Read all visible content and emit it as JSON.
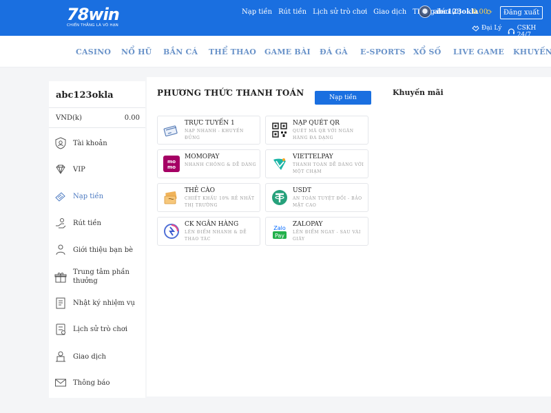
{
  "header": {
    "logo_text": "78win",
    "logo_slogan": "CHIẾN THẮNG LÀ VÔ HẠN",
    "links": [
      "Nạp tiền",
      "Rút tiền",
      "Lịch sử trò chơi",
      "Giao dịch",
      "Thông báo (0)"
    ],
    "username": "abc123okla",
    "balance": "0.00",
    "logout_label": "Đăng xuất",
    "agent_label": "Đại Lý",
    "support_label": "CSKH 24/7"
  },
  "nav": {
    "items": [
      "CASINO",
      "NỔ HŨ",
      "BẮN CÁ",
      "THỂ THAO",
      "GAME BÀI",
      "ĐÁ GÀ",
      "E-SPORTS",
      "XỔ SỐ",
      "LIVE GAME",
      "KHUYẾN MÃI"
    ]
  },
  "sidebar": {
    "username": "abc123okla",
    "balance_label": "VND(k)",
    "balance_value": "0.00",
    "items": [
      {
        "label": "Tài khoản",
        "icon": "user-shield-icon"
      },
      {
        "label": "VIP",
        "icon": "vip-diamond-icon"
      },
      {
        "label": "Nạp tiền",
        "icon": "deposit-icon"
      },
      {
        "label": "Rút tiền",
        "icon": "withdraw-icon"
      },
      {
        "label": "Giới thiệu bạn bè",
        "icon": "refer-friend-icon"
      },
      {
        "label": "Trung tâm phần",
        "label2": "thưởng",
        "icon": "gift-icon"
      },
      {
        "label": "Nhật ký nhiệm vụ",
        "icon": "task-log-icon"
      },
      {
        "label": "Lịch sử trò chơi",
        "icon": "game-history-icon"
      },
      {
        "label": "Giao dịch",
        "icon": "transaction-icon"
      },
      {
        "label": "Thông báo",
        "icon": "mail-icon"
      }
    ],
    "active_index": 2
  },
  "main": {
    "payment_title": "PHƯƠNG THỨC THANH TOÁN",
    "deposit_button": "Nạp tiền",
    "promo_title": "Khuyến mãi",
    "methods": [
      {
        "name": "TRỰC TUYẾN 1",
        "desc": "NẠP NHANH - KHUYẾN ĐỦNG",
        "icon": "online-card-icon"
      },
      {
        "name": "NẠP QUÉT QR",
        "desc": "QUÉT MÃ QR VỚI NGÂN HÀNG ĐA DẠNG",
        "icon": "qr-code-icon"
      },
      {
        "name": "MOMOPAY",
        "desc": "NHANH CHÓNG & DỄ DÀNG",
        "icon": "momo-icon"
      },
      {
        "name": "VIETTELPAY",
        "desc": "THANH TOÁN DỄ DÀNG VỚI MỘT CHẠM",
        "icon": "viettelpay-icon"
      },
      {
        "name": "THẺ CÀO",
        "desc": "CHIẾT KHẤU 10% RẺ NHẤT THỊ TRƯỜNG",
        "icon": "scratch-card-icon"
      },
      {
        "name": "USDT",
        "desc": "AN TOÀN TUYỆT ĐỐI - BẢO MẬT CAO",
        "icon": "usdt-icon"
      },
      {
        "name": "CK NGÂN HÀNG",
        "desc": "LÊN ĐIỂM NHANH & DỄ THAO TÁC",
        "icon": "bank-transfer-icon"
      },
      {
        "name": "ZALOPAY",
        "desc": "LÊN ĐIỂM NGAY - SAU VÀI GIÂY",
        "icon": "zalopay-icon"
      }
    ]
  },
  "colors": {
    "brand_blue": "#1a6fe0",
    "nav_text": "#6a93c9",
    "balance_yellow": "#ffd24d",
    "momo_pink": "#a50064",
    "usdt_green": "#26a17b"
  }
}
